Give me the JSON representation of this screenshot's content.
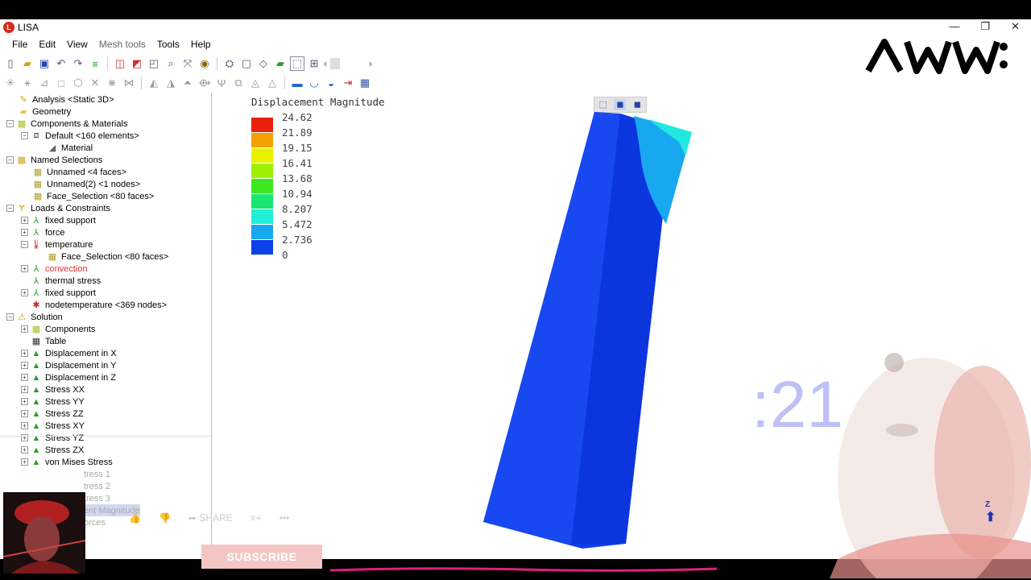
{
  "window": {
    "title": "LISA",
    "minimize": "—",
    "restore": "❐",
    "close": "✕"
  },
  "menu": [
    "File",
    "Edit",
    "View",
    "Mesh tools",
    "Tools",
    "Help"
  ],
  "tree": {
    "analysis": "Analysis <Static 3D>",
    "geometry": "Geometry",
    "components_materials": "Components & Materials",
    "default": "Default <160 elements>",
    "material": "Material",
    "named_selections": "Named Selections",
    "unnamed": "Unnamed <4 faces>",
    "unnamed2": "Unnamed(2) <1 nodes>",
    "face_selection": "Face_Selection <80 faces>",
    "loads": "Loads & Constraints",
    "fixed_support": "fixed support",
    "force": "force",
    "temperature": "temperature",
    "temp_face_selection": "Face_Selection <80 faces>",
    "convection": "convection",
    "thermal_stress": "thermal stress",
    "fixed_support2": "fixed support",
    "nodetemperature": "nodetemperature <369 nodes>",
    "solution": "Solution",
    "components": "Components",
    "table": "Table",
    "disp_x": "Displacement in X",
    "disp_y": "Displacement in Y",
    "disp_z": "Displacement in Z",
    "sxx": "Stress XX",
    "syy": "Stress YY",
    "szz": "Stress ZZ",
    "sxy": "Stress XY",
    "syz": "Stress YZ",
    "szx": "Stress ZX",
    "von_mises": "von Mises Stress",
    "stress1": "tress 1",
    "stress2": "tress 2",
    "stress3": "tress 3",
    "disp_mag": "ent Magnitude",
    "forces": "orces"
  },
  "legend": {
    "title": "Displacement Magnitude",
    "values": [
      "24.62",
      "21.89",
      "19.15",
      "16.41",
      "13.68",
      "10.94",
      "8.207",
      "5.472",
      "2.736",
      "0"
    ],
    "colors": [
      "#e8200c",
      "#f4a000",
      "#e8f000",
      "#9cf000",
      "#3ce820",
      "#18e870",
      "#20f0d8",
      "#18a8f0",
      "#0c40e8"
    ]
  },
  "viewport": {
    "axis_label": "Z"
  },
  "overlay": {
    "timer": ":21",
    "share": "SHARE",
    "subscribe": "SUBSCRIBE"
  }
}
